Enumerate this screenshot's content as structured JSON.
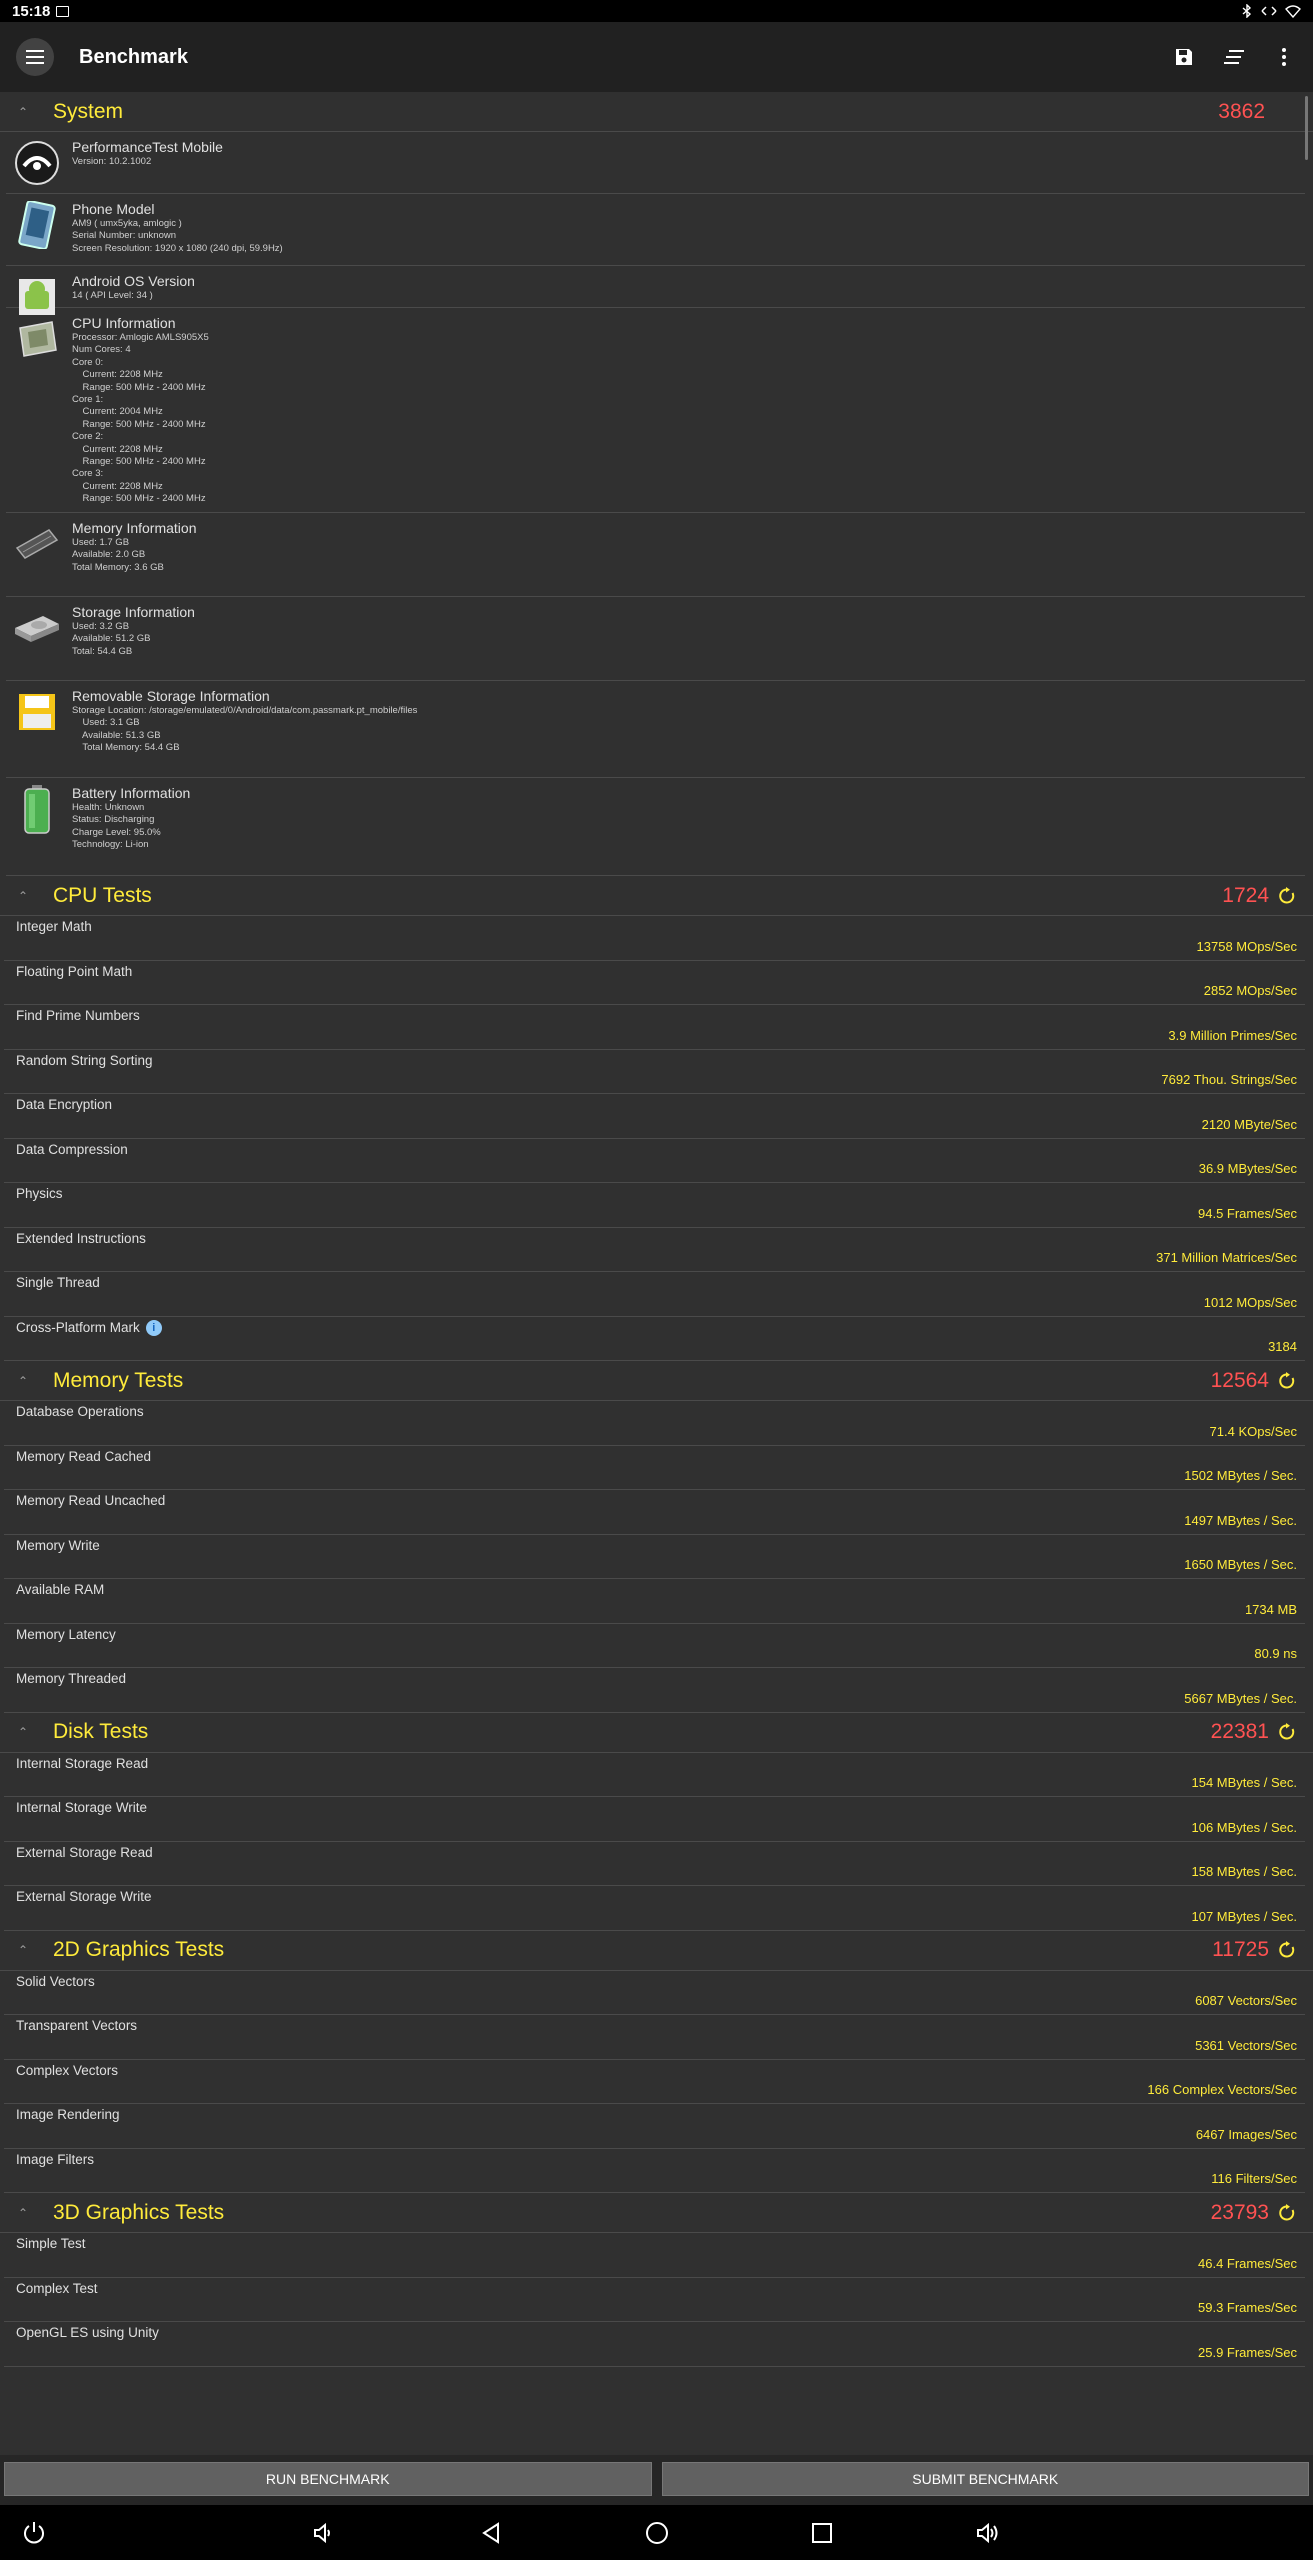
{
  "status_bar": {
    "time": "15:18"
  },
  "app_bar": {
    "title": "Benchmark",
    "actions": [
      "save-icon",
      "sort-icon",
      "more-vert-icon"
    ]
  },
  "system": {
    "title": "System",
    "score": "3862",
    "items": [
      {
        "icon": "app-logo-icon",
        "title": "PerformanceTest Mobile",
        "lines": [
          "Version: 10.2.1002"
        ]
      },
      {
        "icon": "phone-icon",
        "title": "Phone Model",
        "lines": [
          "AM9 ( umx5yka, amlogic )",
          "Serial Number: unknown",
          "Screen Resolution: 1920 x 1080 (240 dpi, 59.9Hz)"
        ]
      },
      {
        "icon": "android-icon",
        "title": "Android OS Version",
        "lines": [
          "14 ( API Level: 34 )"
        ]
      },
      {
        "icon": "cpu-icon",
        "title": "CPU Information",
        "lines": [
          "Processor: Amlogic AMLS905X5",
          "Num Cores: 4",
          "Core 0:",
          "    Current: 2208 MHz",
          "    Range: 500 MHz - 2400 MHz",
          "Core 1:",
          "    Current: 2004 MHz",
          "    Range: 500 MHz - 2400 MHz",
          "Core 2:",
          "    Current: 2208 MHz",
          "    Range: 500 MHz - 2400 MHz",
          "Core 3:",
          "    Current: 2208 MHz",
          "    Range: 500 MHz - 2400 MHz"
        ]
      },
      {
        "icon": "memory-chip-icon",
        "title": "Memory Information",
        "lines": [
          "Used: 1.7 GB",
          "Available: 2.0 GB",
          "Total Memory: 3.6 GB"
        ]
      },
      {
        "icon": "hard-drive-icon",
        "title": "Storage Information",
        "lines": [
          "Used: 3.2 GB",
          "Available: 51.2 GB",
          "Total: 54.4 GB"
        ]
      },
      {
        "icon": "sd-card-icon",
        "title": "Removable Storage Information",
        "lines": [
          "Storage Location: /storage/emulated/0/Android/data/com.passmark.pt_mobile/files",
          "    Used: 3.1 GB",
          "    Available: 51.3 GB",
          "    Total Memory: 54.4 GB"
        ]
      },
      {
        "icon": "battery-icon",
        "title": "Battery Information",
        "lines": [
          "Health: Unknown",
          "Status: Discharging",
          "Charge Level: 95.0%",
          "Technology: Li-ion"
        ]
      }
    ]
  },
  "sections": [
    {
      "key": "cpu",
      "title": "CPU Tests",
      "score": "1724",
      "tests": [
        {
          "name": "Integer Math",
          "value": "13758 MOps/Sec"
        },
        {
          "name": "Floating Point Math",
          "value": "2852 MOps/Sec"
        },
        {
          "name": "Find Prime Numbers",
          "value": "3.9 Million Primes/Sec"
        },
        {
          "name": "Random String Sorting",
          "value": "7692 Thou. Strings/Sec"
        },
        {
          "name": "Data Encryption",
          "value": "2120 MByte/Sec"
        },
        {
          "name": "Data Compression",
          "value": "36.9 MBytes/Sec"
        },
        {
          "name": "Physics",
          "value": "94.5 Frames/Sec"
        },
        {
          "name": "Extended Instructions",
          "value": "371 Million Matrices/Sec"
        },
        {
          "name": "Single Thread",
          "value": "1012 MOps/Sec"
        },
        {
          "name": "Cross-Platform Mark",
          "value": "3184",
          "info": true
        }
      ]
    },
    {
      "key": "memory",
      "title": "Memory Tests",
      "score": "12564",
      "tests": [
        {
          "name": "Database Operations",
          "value": "71.4 KOps/Sec"
        },
        {
          "name": "Memory Read Cached",
          "value": "1502 MBytes / Sec."
        },
        {
          "name": "Memory Read Uncached",
          "value": "1497 MBytes / Sec."
        },
        {
          "name": "Memory Write",
          "value": "1650 MBytes / Sec."
        },
        {
          "name": "Available RAM",
          "value": "1734 MB"
        },
        {
          "name": "Memory Latency",
          "value": "80.9 ns"
        },
        {
          "name": "Memory Threaded",
          "value": "5667 MBytes / Sec."
        }
      ]
    },
    {
      "key": "disk",
      "title": "Disk Tests",
      "score": "22381",
      "tests": [
        {
          "name": "Internal Storage Read",
          "value": "154 MBytes / Sec."
        },
        {
          "name": "Internal Storage Write",
          "value": "106 MBytes / Sec."
        },
        {
          "name": "External Storage Read",
          "value": "158 MBytes / Sec."
        },
        {
          "name": "External Storage Write",
          "value": "107 MBytes / Sec."
        }
      ]
    },
    {
      "key": "graphics2d",
      "title": "2D Graphics Tests",
      "score": "11725",
      "tests": [
        {
          "name": "Solid Vectors",
          "value": "6087 Vectors/Sec"
        },
        {
          "name": "Transparent Vectors",
          "value": "5361 Vectors/Sec"
        },
        {
          "name": "Complex Vectors",
          "value": "166 Complex Vectors/Sec"
        },
        {
          "name": "Image Rendering",
          "value": "6467 Images/Sec"
        },
        {
          "name": "Image Filters",
          "value": "116 Filters/Sec"
        }
      ]
    },
    {
      "key": "graphics3d",
      "title": "3D Graphics Tests",
      "score": "23793",
      "tests": [
        {
          "name": "Simple Test",
          "value": "46.4 Frames/Sec"
        },
        {
          "name": "Complex Test",
          "value": "59.3 Frames/Sec"
        },
        {
          "name": "OpenGL ES using Unity",
          "value": "25.9 Frames/Sec"
        }
      ]
    }
  ],
  "buttons": {
    "run": "RUN BENCHMARK",
    "submit": "SUBMIT BENCHMARK"
  },
  "nav_bar": [
    "power-icon",
    "volume-down-icon",
    "back-icon",
    "home-icon",
    "recents-icon",
    "volume-up-icon"
  ],
  "colors": {
    "section_title": "#ffeb3b",
    "score": "#ff5252",
    "value": "#ffeb3b",
    "background": "#303030",
    "app_bar": "#212121"
  }
}
